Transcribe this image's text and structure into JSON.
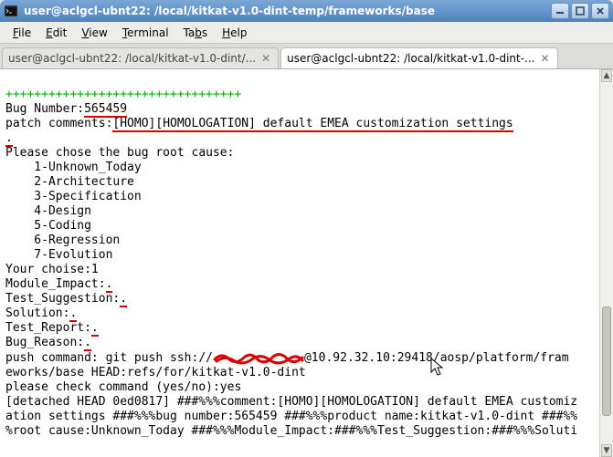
{
  "window": {
    "title": "user@aclgcl-ubnt22: /local/kitkat-v1.0-dint-temp/frameworks/base"
  },
  "menu": {
    "file": "File",
    "edit": "Edit",
    "view": "View",
    "terminal": "Terminal",
    "tabs": "Tabs",
    "help": "Help"
  },
  "tabs": [
    {
      "label": "user@aclgcl-ubnt22: /local/kitkat-v1.0-dint/...",
      "active": false
    },
    {
      "label": "user@aclgcl-ubnt22: /local/kitkat-v1.0-dint-...",
      "active": true
    }
  ],
  "term": {
    "pluses": "+++++++++++++++++++++++++++++++++",
    "bug_label": "Bug Number:",
    "bug_value": "565459",
    "patch_label": "patch comments:",
    "patch_value": "[HOMO][HOMOLOGATION] default EMEA customization settings",
    "rootcause_prompt": "Please chose the bug root cause:",
    "opts": {
      "o1": "    1-Unknown_Today",
      "o2": "    2-Architecture",
      "o3": "    3-Specification",
      "o4": "    4-Design",
      "o5": "    5-Coding",
      "o6": "    6-Regression",
      "o7": "    7-Evolution"
    },
    "choice_line": "Your choise:1",
    "module_label": "Module_Impact:",
    "test_sugg_label": "Test_Suggestion:",
    "solution_label": "Solution:",
    "test_report_label": "Test_Report:",
    "bug_reason_label": "Bug_Reason:",
    "dotval": ".",
    "push_pre": "push command: git push ssh://",
    "push_post": "@10.92.32.10:29418/aosp/platform/fram",
    "push_line2": "eworks/base HEAD:refs/for/kitkat-v1.0-dint",
    "confirm": "please check command (yes/no):yes",
    "detached1": "[detached HEAD 0ed0817] ###%%%comment:[HOMO][HOMOLOGATION] default EMEA customiz",
    "detached2": "ation settings ###%%%bug number:565459 ###%%%product name:kitkat-v1.0-dint ###%%",
    "detached3": "%root cause:Unknown_Today ###%%%Module_Impact:###%%%Test_Suggestion:###%%%Soluti"
  }
}
